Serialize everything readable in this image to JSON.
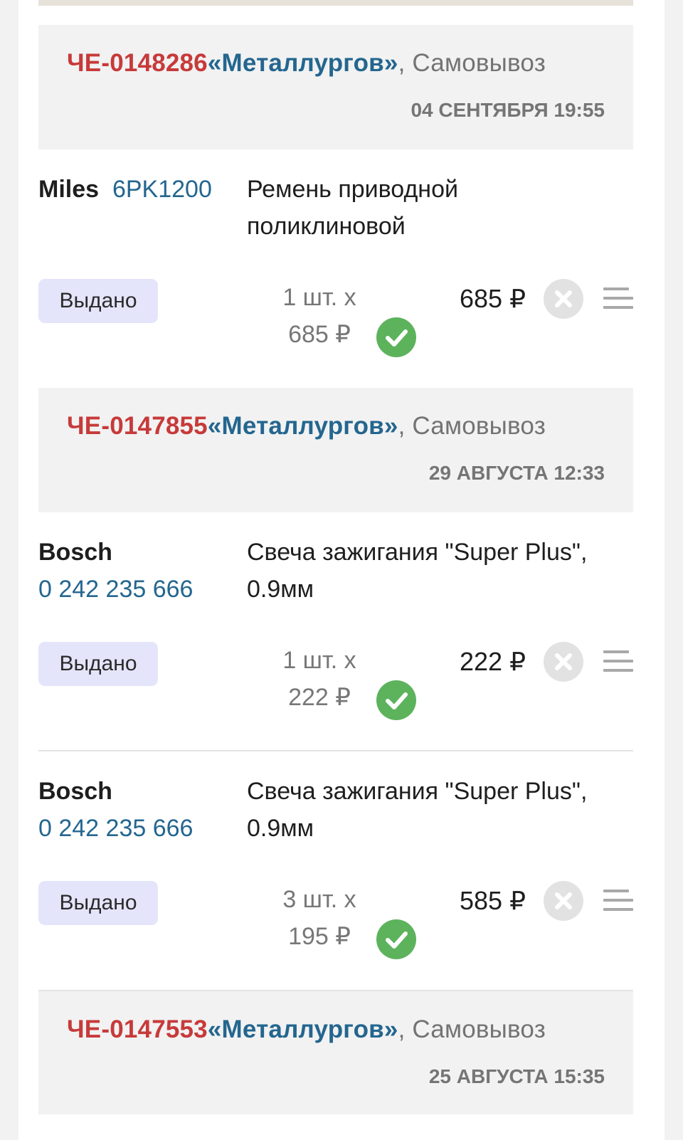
{
  "orders": [
    {
      "number": "ЧЕ-0148286",
      "store": "«Металлургов»",
      "delivery": ", Самовывоз",
      "date": "04 СЕНТЯБРЯ 19:55",
      "items": [
        {
          "brand": "Miles",
          "article": "6PK1200",
          "description": "Ремень приводной поликлиновой",
          "status": "Выдано",
          "qty": "1 шт. х",
          "unit_price": "685 ₽",
          "total": "685 ₽"
        }
      ]
    },
    {
      "number": "ЧЕ-0147855",
      "store": "«Металлургов»",
      "delivery": ", Самовывоз",
      "date": "29 АВГУСТА 12:33",
      "items": [
        {
          "brand": "Bosch",
          "article": "0 242 235 666",
          "description": "Свеча зажигания \"Super Plus\", 0.9мм",
          "status": "Выдано",
          "qty": "1 шт. х",
          "unit_price": "222 ₽",
          "total": "222 ₽"
        },
        {
          "brand": "Bosch",
          "article": "0 242 235 666",
          "description": "Свеча зажигания \"Super Plus\", 0.9мм",
          "status": "Выдано",
          "qty": "3 шт. х",
          "unit_price": "195 ₽",
          "total": "585 ₽"
        }
      ]
    },
    {
      "number": "ЧЕ-0147553",
      "store": "«Металлургов»",
      "delivery": ", Самовывоз",
      "date": "25 АВГУСТА 15:35",
      "items": []
    }
  ],
  "colors": {
    "order_number": "#c73a3a",
    "store": "#24668f",
    "status_pill": "#e4e5fb",
    "check": "#5cb35c"
  },
  "icons": {
    "check": "check-circle-icon",
    "remove": "close-circle-icon",
    "menu": "menu-lines-icon"
  }
}
